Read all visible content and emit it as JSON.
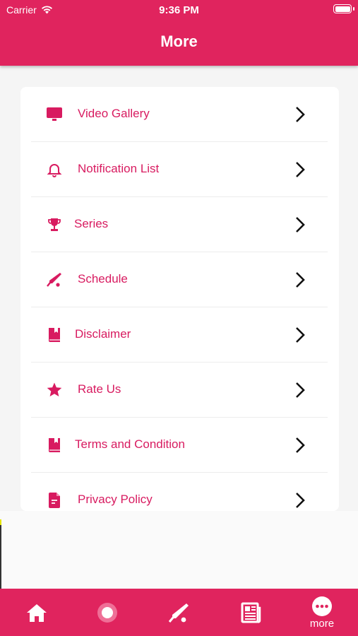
{
  "status": {
    "carrier": "Carrier",
    "time": "9:36 PM"
  },
  "header": {
    "title": "More"
  },
  "menu": {
    "items": [
      {
        "label": "Video Gallery",
        "icon": "monitor-icon"
      },
      {
        "label": "Notification List",
        "icon": "bell-icon"
      },
      {
        "label": "Series",
        "icon": "trophy-icon"
      },
      {
        "label": "Schedule",
        "icon": "cricket-bat-icon"
      },
      {
        "label": "Disclaimer",
        "icon": "book-icon"
      },
      {
        "label": "Rate Us",
        "icon": "star-icon"
      },
      {
        "label": "Terms and Condition",
        "icon": "book-icon"
      },
      {
        "label": "Privacy Policy",
        "icon": "document-icon"
      }
    ]
  },
  "tabbar": {
    "items": [
      {
        "icon": "home-icon",
        "label": ""
      },
      {
        "icon": "live-icon",
        "label": ""
      },
      {
        "icon": "cricket-bat-icon",
        "label": ""
      },
      {
        "icon": "news-icon",
        "label": ""
      },
      {
        "icon": "more-icon",
        "label": "more"
      }
    ]
  },
  "colors": {
    "primary": "#e0245e",
    "accent": "#d81b60",
    "background": "#f5f5f5"
  }
}
